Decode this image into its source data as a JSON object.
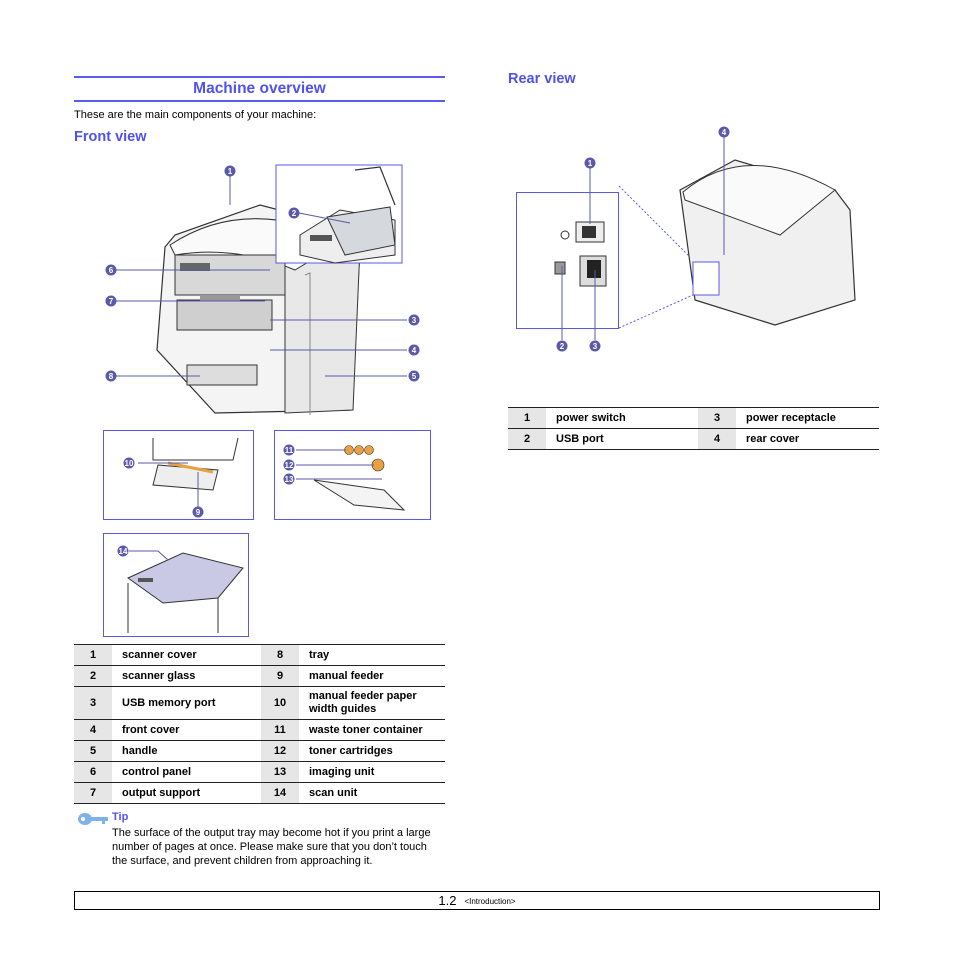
{
  "header": {
    "title": "Machine overview"
  },
  "intro": "These are the main components of your machine:",
  "front_view": {
    "title": "Front view",
    "callouts": [
      "1",
      "2",
      "3",
      "4",
      "5",
      "6",
      "7",
      "8",
      "9",
      "10",
      "11",
      "12",
      "13",
      "14"
    ],
    "parts": [
      {
        "n": "1",
        "label": "scanner cover",
        "n2": "8",
        "label2": "tray"
      },
      {
        "n": "2",
        "label": "scanner glass",
        "n2": "9",
        "label2": "manual feeder"
      },
      {
        "n": "3",
        "label": "USB memory port",
        "n2": "10",
        "label2": "manual feeder paper width guides"
      },
      {
        "n": "4",
        "label": "front cover",
        "n2": "11",
        "label2": "waste toner container"
      },
      {
        "n": "5",
        "label": "handle",
        "n2": "12",
        "label2": "toner cartridges"
      },
      {
        "n": "6",
        "label": "control panel",
        "n2": "13",
        "label2": "imaging unit"
      },
      {
        "n": "7",
        "label": "output support",
        "n2": "14",
        "label2": "scan unit"
      }
    ]
  },
  "rear_view": {
    "title": "Rear view",
    "callouts": [
      "1",
      "2",
      "3",
      "4"
    ],
    "parts": [
      {
        "n": "1",
        "label": "power switch",
        "n2": "3",
        "label2": "power receptacle"
      },
      {
        "n": "2",
        "label": "USB port",
        "n2": "4",
        "label2": "rear cover"
      }
    ]
  },
  "tip": {
    "icon": "key-icon",
    "title": "Tip",
    "text": "The surface of the output tray may become hot if you print a large number of pages at once. Please make sure that you don’t touch the surface, and prevent children from approaching it."
  },
  "footer": {
    "page": "1.2",
    "section": "<Introduction>"
  },
  "colors": {
    "accent": "#4f52ec",
    "callout": "#5b59a8",
    "table_num_bg": "#e6e6e6"
  }
}
